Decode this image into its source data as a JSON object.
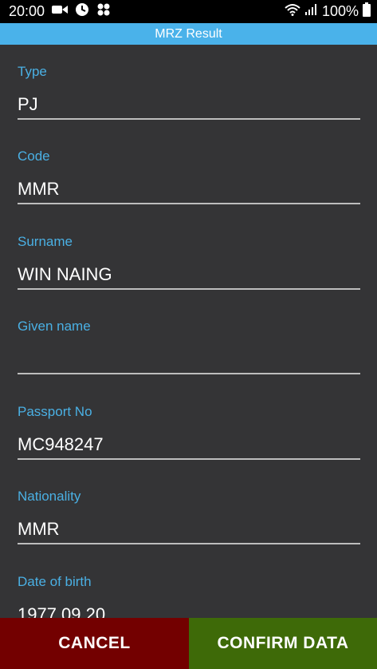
{
  "status_bar": {
    "time": "20:00",
    "battery": "100%",
    "left_icons": [
      "video-camera-icon",
      "clock-icon",
      "app-grid-icon"
    ],
    "right_icons": [
      "wifi-icon",
      "signal-icon",
      "battery-icon"
    ]
  },
  "header": {
    "title": "MRZ Result"
  },
  "fields": [
    {
      "label": "Type",
      "value": "PJ"
    },
    {
      "label": "Code",
      "value": "MMR"
    },
    {
      "label": "Surname",
      "value": "WIN NAING"
    },
    {
      "label": "Given name",
      "value": ""
    },
    {
      "label": "Passport No",
      "value": "MC948247"
    },
    {
      "label": "Nationality",
      "value": "MMR"
    },
    {
      "label": "Date of birth",
      "value": "1977.09.20"
    }
  ],
  "buttons": {
    "cancel": "CANCEL",
    "confirm": "CONFIRM DATA"
  },
  "colors": {
    "accent": "#4ab2ea",
    "label": "#4ab0e4",
    "background": "#343436",
    "cancel": "#730000",
    "confirm": "#3e6a08"
  }
}
